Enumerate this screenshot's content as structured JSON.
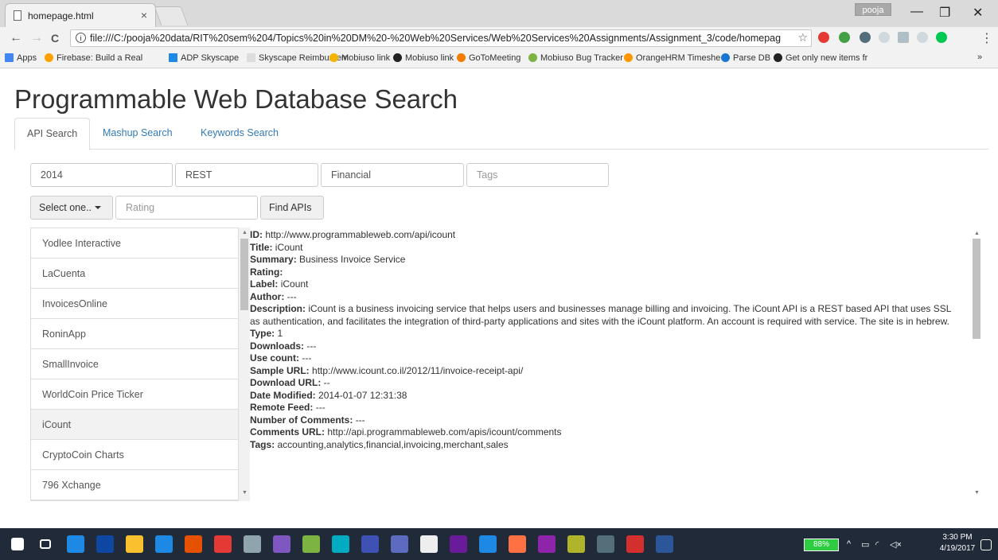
{
  "browser": {
    "tab_title": "homepage.html",
    "tab_close": "×",
    "profile": "pooja",
    "minimize": "—",
    "restore": "❐",
    "close": "✕",
    "back": "←",
    "forward": "→",
    "reload": "C",
    "url": "file:///C:/pooja%20data/RIT%20sem%204/Topics%20in%20DM%20-%20Web%20Services/Web%20Services%20Assignments/Assignment_3/code/homepag",
    "star": "☆",
    "menu": "⋮"
  },
  "bookmarks": [
    {
      "label": "Apps",
      "color": "#4285f4"
    },
    {
      "label": "Firebase: Build a Real",
      "color": "#ffa000"
    },
    {
      "label": "ADP Skyscape",
      "color": "#1e88e5"
    },
    {
      "label": "Skyscape Reimbursem",
      "color": "#cccccc"
    },
    {
      "label": "Mobiuso link",
      "color": "#f4b400"
    },
    {
      "label": "Mobiuso link",
      "color": "#222222"
    },
    {
      "label": "GoToMeeting",
      "color": "#f57c00"
    },
    {
      "label": "Mobiuso Bug Tracker",
      "color": "#7cb342"
    },
    {
      "label": "OrangeHRM Timeshe",
      "color": "#ff9800"
    },
    {
      "label": "Parse DB",
      "color": "#1976d2"
    },
    {
      "label": "Get only new items fr",
      "color": "#222222"
    }
  ],
  "bookmarks_more": "»",
  "page": {
    "title": "Programmable Web Database Search",
    "tabs": [
      "API Search",
      "Mashup Search",
      "Keywords Search"
    ]
  },
  "search": {
    "year_value": "2014",
    "protocol_value": "REST",
    "category_value": "Financial",
    "tags_placeholder": "Tags",
    "select_label": "Select one..",
    "rating_placeholder": "Rating",
    "find_button": "Find APIs"
  },
  "results": [
    "Yodlee Interactive",
    "LaCuenta",
    "InvoicesOnline",
    "RoninApp",
    "SmallInvoice",
    "WorldCoin Price Ticker",
    "iCount",
    "CryptoCoin Charts",
    "796 Xchange"
  ],
  "details": [
    {
      "label": "ID:",
      "value": "http://www.programmableweb.com/api/icount"
    },
    {
      "label": "Title:",
      "value": "iCount"
    },
    {
      "label": "Summary:",
      "value": "Business Invoice Service"
    },
    {
      "label": "Rating:",
      "value": ""
    },
    {
      "label": "Label:",
      "value": "iCount"
    },
    {
      "label": "Author:",
      "value": "---"
    },
    {
      "label": "Description:",
      "value": "iCount is a business invoicing service that helps users and businesses manage billing and invoicing. The iCount API is a REST based API that uses SSL as authentication, and facilitates the integration of third-party applications and sites with the iCount platform. An account is required with service. The site is in hebrew."
    },
    {
      "label": "Type:",
      "value": "1"
    },
    {
      "label": "Downloads:",
      "value": "---"
    },
    {
      "label": "Use count:",
      "value": "---"
    },
    {
      "label": "Sample URL:",
      "value": "http://www.icount.co.il/2012/11/invoice-receipt-api/"
    },
    {
      "label": "Download URL:",
      "value": "--"
    },
    {
      "label": "Date Modified:",
      "value": "2014-01-07 12:31:38"
    },
    {
      "label": "Remote Feed:",
      "value": "---"
    },
    {
      "label": "Number of Comments:",
      "value": "---"
    },
    {
      "label": "Comments URL:",
      "value": "http://api.programmableweb.com/apis/icount/comments"
    },
    {
      "label": "Tags:",
      "value": "accounting,analytics,financial,invoicing,merchant,sales"
    }
  ],
  "taskbar": {
    "battery": "88%",
    "time": "3:30 PM",
    "date": "4/19/2017",
    "icons": [
      "#1e88e5",
      "#0d47a1",
      "#fbc02d",
      "#1e88e5",
      "#e65100",
      "#e53935",
      "#90a4ae",
      "#7e57c2",
      "#7cb342",
      "#00acc1",
      "#3f51b5",
      "#5c6bc0",
      "#eeeeee",
      "#6a1b9a",
      "#1e88e5",
      "#ff7043",
      "#8e24aa",
      "#afb42b",
      "#546e7a",
      "#d32f2f",
      "#2b579a"
    ]
  }
}
